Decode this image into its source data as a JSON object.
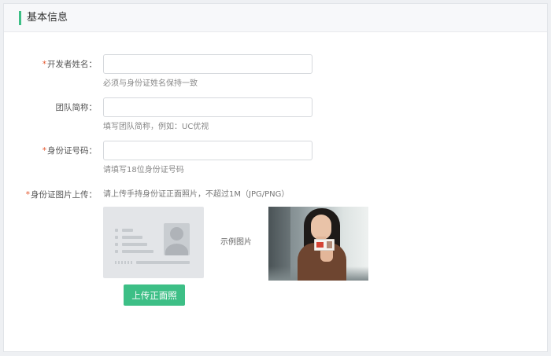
{
  "section": {
    "title": "基本信息"
  },
  "form": {
    "required_mark": "*",
    "developer_name": {
      "label": "开发者姓名：",
      "value": "",
      "placeholder": "",
      "hint": "必须与身份证姓名保持一致"
    },
    "team_short_name": {
      "label": "团队简称：",
      "value": "",
      "placeholder": "",
      "hint": "填写团队简称，例如：UC优视"
    },
    "id_number": {
      "label": "身份证号码：",
      "value": "",
      "placeholder": "",
      "hint": "请填写18位身份证号码"
    },
    "id_photo": {
      "label": "身份证图片上传：",
      "hint": "请上传手持身份证正面照片，不超过1M（JPG/PNG）",
      "upload_button": "上传正面照",
      "sample_label": "示例图片"
    }
  },
  "colors": {
    "accent": "#3dbf86",
    "required": "#e4572e"
  },
  "icons": {
    "id_card_placeholder": "id-card-placeholder-icon",
    "sample_photo": "person-holding-id-card"
  }
}
